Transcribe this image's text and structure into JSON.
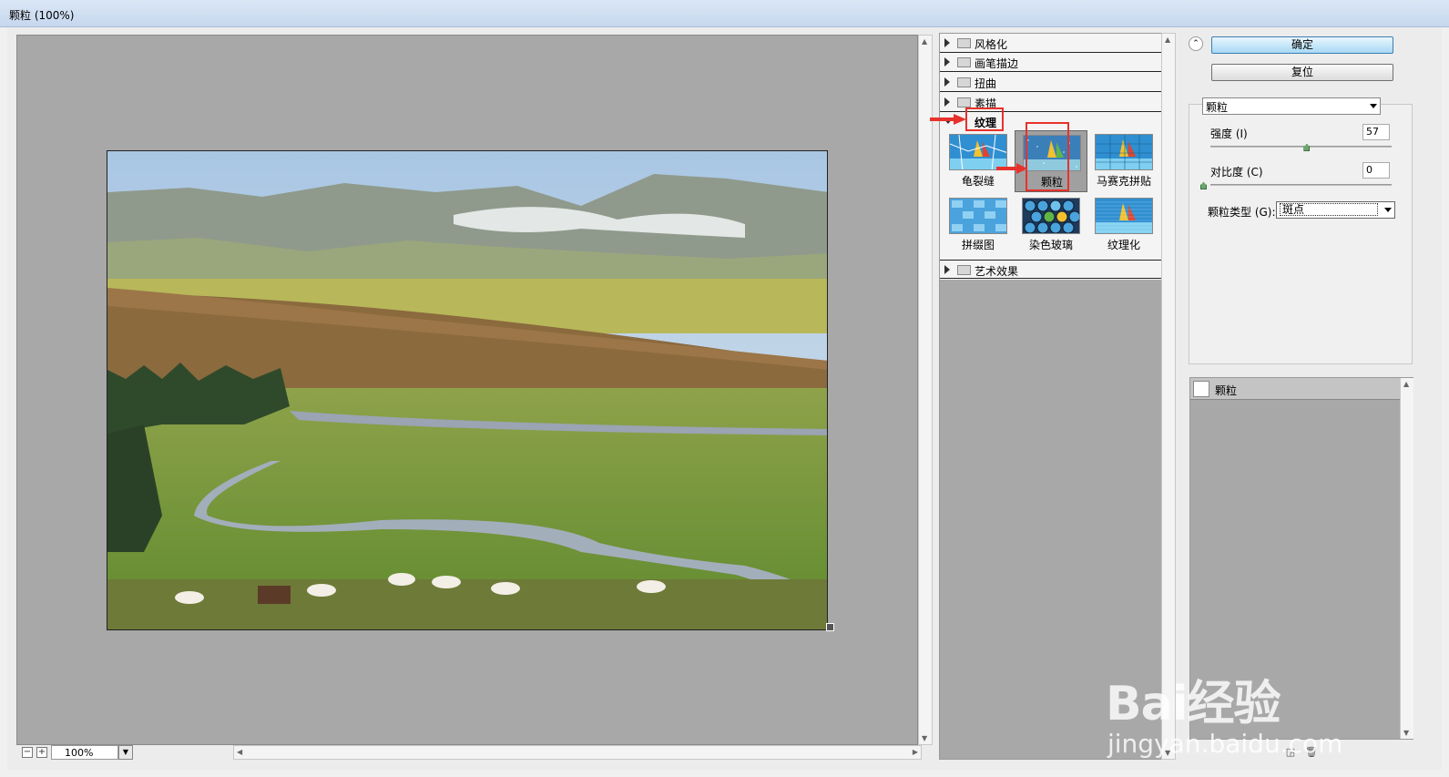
{
  "window": {
    "title": "颗粒 (100%)"
  },
  "preview": {
    "zoom": "100%",
    "zoom_out": "−",
    "zoom_in": "+"
  },
  "filter_tree": {
    "folders": [
      {
        "label": "风格化",
        "expanded": false
      },
      {
        "label": "画笔描边",
        "expanded": false
      },
      {
        "label": "扭曲",
        "expanded": false
      },
      {
        "label": "素描",
        "expanded": false
      },
      {
        "label": "纹理",
        "expanded": true
      },
      {
        "label": "艺术效果",
        "expanded": false
      }
    ],
    "texture_filters": [
      {
        "label": "龟裂缝",
        "selected": false,
        "icon": "craquelure-thumb"
      },
      {
        "label": "颗粒",
        "selected": true,
        "icon": "grain-thumb"
      },
      {
        "label": "马赛克拼贴",
        "selected": false,
        "icon": "mosaic-tiles-thumb"
      },
      {
        "label": "拼缀图",
        "selected": false,
        "icon": "patchwork-thumb"
      },
      {
        "label": "染色玻璃",
        "selected": false,
        "icon": "stained-glass-thumb"
      },
      {
        "label": "纹理化",
        "selected": false,
        "icon": "texturizer-thumb"
      }
    ]
  },
  "controls": {
    "ok_label": "确定",
    "reset_label": "复位",
    "selected_filter": "颗粒",
    "intensity": {
      "label": "强度 (I)",
      "value": "57",
      "fraction": 0.57
    },
    "contrast": {
      "label": "对比度 (C)",
      "value": "0",
      "fraction": 0.0
    },
    "grain_type": {
      "label": "颗粒类型 (G):",
      "value": "斑点"
    }
  },
  "layers": {
    "items": [
      {
        "label": "颗粒"
      }
    ]
  },
  "watermark": {
    "brand": "Bai经验",
    "url": "jingyan.baidu.com"
  },
  "colors": {
    "accent_red": "#e8312a",
    "panel_gray": "#a8a8a8",
    "primary_button": "#a7d9f5"
  }
}
